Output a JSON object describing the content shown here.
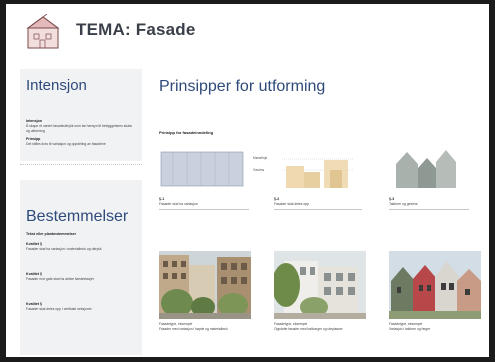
{
  "header": {
    "title": "TEMA: Fasade"
  },
  "left": {
    "intensjon": {
      "heading": "Intensjon",
      "p1_title": "Intensjon",
      "p1_text": "Å skape et variert fasadeuttrykk som tar hensyn til bebyggelsens skala og utforming",
      "p2_title": "Prinsipp",
      "p2_text": "Det stilles krav til variasjon og oppdeling av fasadene"
    },
    "bestemmelser": {
      "heading": "Bestemmelser",
      "intro": "Tekst eller planbestemmelser",
      "groups": [
        {
          "title": "Kvalitet §",
          "text": "Fasader skal ha variasjon i materialbruk og uttrykk"
        },
        {
          "title": "Kvalitet §",
          "text": "Fasader mot gate skal ha aktive førsteetasjer"
        },
        {
          "title": "Kvalitet §",
          "text": "Fasader skal deles opp i vertikale seksjoner"
        }
      ]
    }
  },
  "main": {
    "heading": "Prinsipper for utforming",
    "subheading": "Prinsipp for fasadeinndeling",
    "diagram_labels": [
      "Mønelinje",
      "Gesims"
    ],
    "columns": [
      {
        "head": "§-1",
        "text": "Fasader skal ha variasjon",
        "caption": "Fasadetype, eksempel",
        "caption2": "Fasader med variasjon i høyde og materialbruk"
      },
      {
        "head": "§-2",
        "text": "Fasader skal deles opp",
        "caption": "Fasadetype, eksempel",
        "caption2": "Oppdelte fasader med balkonger og uteplasser"
      },
      {
        "head": "§-3",
        "text": "Takform og gesims",
        "caption": "Fasadetype, eksempel",
        "caption2": "Variasjon i takform og farger"
      }
    ]
  },
  "colors": {
    "heading_blue": "#2e4a7a",
    "title_gray": "#3a3f4a",
    "panel": "#f1f2f4",
    "house_fill": "#d9aeae"
  }
}
